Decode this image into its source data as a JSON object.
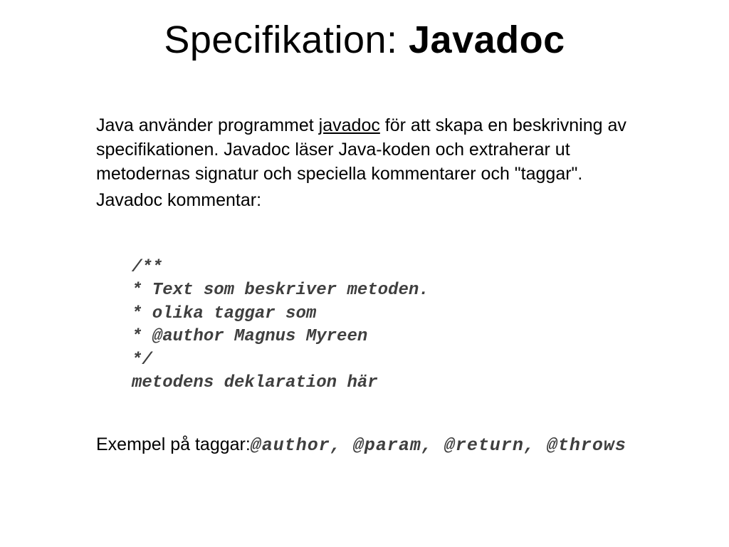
{
  "title": {
    "plain": "Specifikation: ",
    "bold": "Javadoc"
  },
  "body": {
    "p1_a": "Java använder programmet ",
    "p1_u": "javadoc",
    "p1_b": " för att skapa en beskrivning av specifikationen. Javadoc läser Java-koden och extraherar ut metodernas signatur och speciella kommentarer och \"taggar\".",
    "p2": "Javadoc kommentar:"
  },
  "code": {
    "l1": "/**",
    "l2": "* Text som beskriver metoden.",
    "l3": "* olika taggar som",
    "l4": "* @author Magnus Myreen",
    "l5": "*/",
    "l6": "metodens deklaration här"
  },
  "footer": {
    "label": "Exempel på taggar:",
    "tags": "@author, @param, @return, @throws"
  }
}
